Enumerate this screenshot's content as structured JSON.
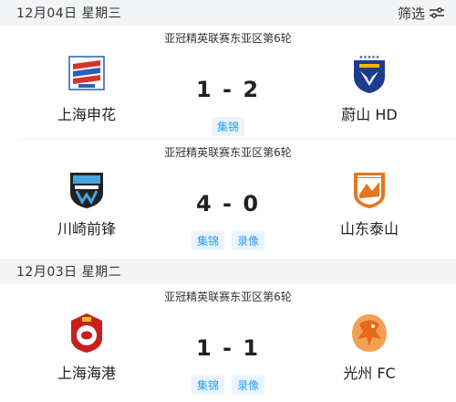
{
  "filter_label": "筛选",
  "colors": {
    "accent": "#2a9df4",
    "tag_bg": "#eaf4fd",
    "date_bg": "#f3f4f6"
  },
  "days": [
    {
      "date": "12月04日  星期三",
      "matches": [
        {
          "competition": "亚冠精英联赛东亚区第6轮",
          "home": {
            "name": "上海申花",
            "logo": "shanghai-shenhua-logo"
          },
          "away": {
            "name": "蔚山 HD",
            "logo": "ulsan-hd-logo"
          },
          "score": "1 - 2",
          "tags": [
            "集锦"
          ]
        },
        {
          "competition": "亚冠精英联赛东亚区第6轮",
          "home": {
            "name": "川崎前锋",
            "logo": "kawasaki-frontale-logo"
          },
          "away": {
            "name": "山东泰山",
            "logo": "shandong-taishan-logo"
          },
          "score": "4 - 0",
          "tags": [
            "集锦",
            "录像"
          ]
        }
      ]
    },
    {
      "date": "12月03日  星期二",
      "matches": [
        {
          "competition": "亚冠精英联赛东亚区第6轮",
          "home": {
            "name": "上海海港",
            "logo": "shanghai-port-logo"
          },
          "away": {
            "name": "光州 FC",
            "logo": "gwangju-fc-logo"
          },
          "score": "1 - 1",
          "tags": [
            "集锦",
            "录像"
          ]
        }
      ]
    }
  ]
}
